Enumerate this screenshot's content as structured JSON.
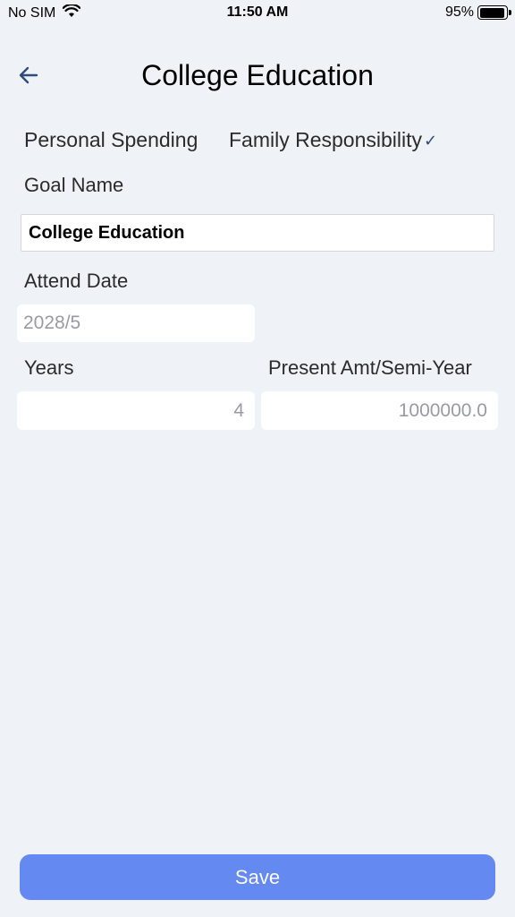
{
  "status_bar": {
    "carrier": "No SIM",
    "time": "11:50 AM",
    "battery": "95%",
    "battery_level": 0.95
  },
  "nav": {
    "back_icon": "arrow-left-icon",
    "title": "College Education"
  },
  "tabs": {
    "personal": "Personal Spending",
    "family": "Family Responsibility",
    "selected": "family",
    "check_icon": "checkmark-icon"
  },
  "form": {
    "goal_name_label": "Goal Name",
    "goal_name_value": "College Education",
    "attend_date_label": "Attend Date",
    "attend_date_value": "2028/5",
    "years_label": "Years",
    "years_value": "4",
    "present_amt_label": "Present Amt/Semi-Year",
    "present_amt_value": "1000000.0"
  },
  "actions": {
    "save_label": "Save"
  },
  "colors": {
    "background": "#eff2f6",
    "accent": "#6489f0",
    "nav_icon": "#2f4a7c"
  }
}
